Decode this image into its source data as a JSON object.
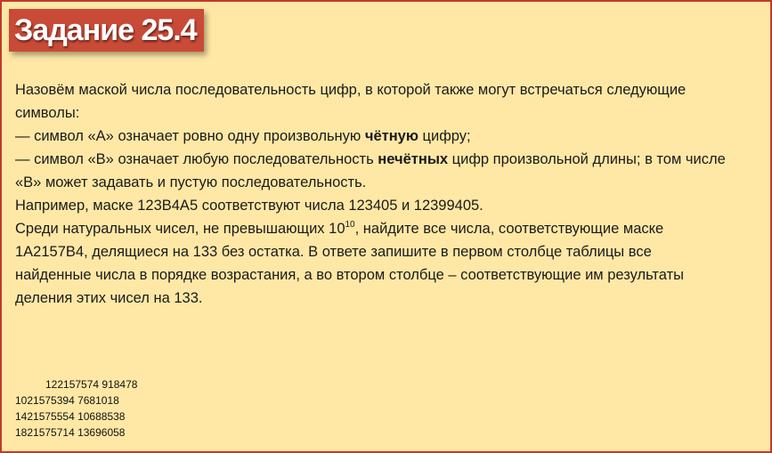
{
  "title": "Задание 25.4",
  "task": {
    "p1_l1": "Назовём маской числа последовательность цифр, в которой также могут встречаться следующие",
    "p1_l2": "символы:",
    "a_pre": "— символ «A» означает ровно одну произвольную ",
    "a_bold": "чётную",
    "a_post": " цифру;",
    "b_pre": "— символ «B» означает любую последовательность ",
    "b_bold": "нечётных",
    "b_post": " цифр произвольной длины; в том числе",
    "b_l2": "«B» может задавать и пустую последовательность.",
    "example": "Например, маске 123B4A5 соответствуют числа 123405 и 12399405.",
    "q_l1_pre": "Среди натуральных чисел, не превышающих 10",
    "q_l1_sup": "10",
    "q_l1_post": ", найдите все числа, соответствующие маске",
    "q_l2": "1A2157B4, делящиеся на 133 без остатка. В ответе запишите в первом столбце таблицы все",
    "q_l3": "найденные числа в порядке возрастания, а во втором столбце – соответствующие им результаты",
    "q_l4": "деления этих чисел на 133."
  },
  "answers": [
    "122157574 918478",
    "1021575394 7681018",
    "1421575554 10688538",
    "1821575714 13696058"
  ],
  "colors": {
    "background": "#ffe8a6",
    "border": "#c0392b",
    "title_badge": "#c94a36",
    "title_text": "#ffffff"
  }
}
